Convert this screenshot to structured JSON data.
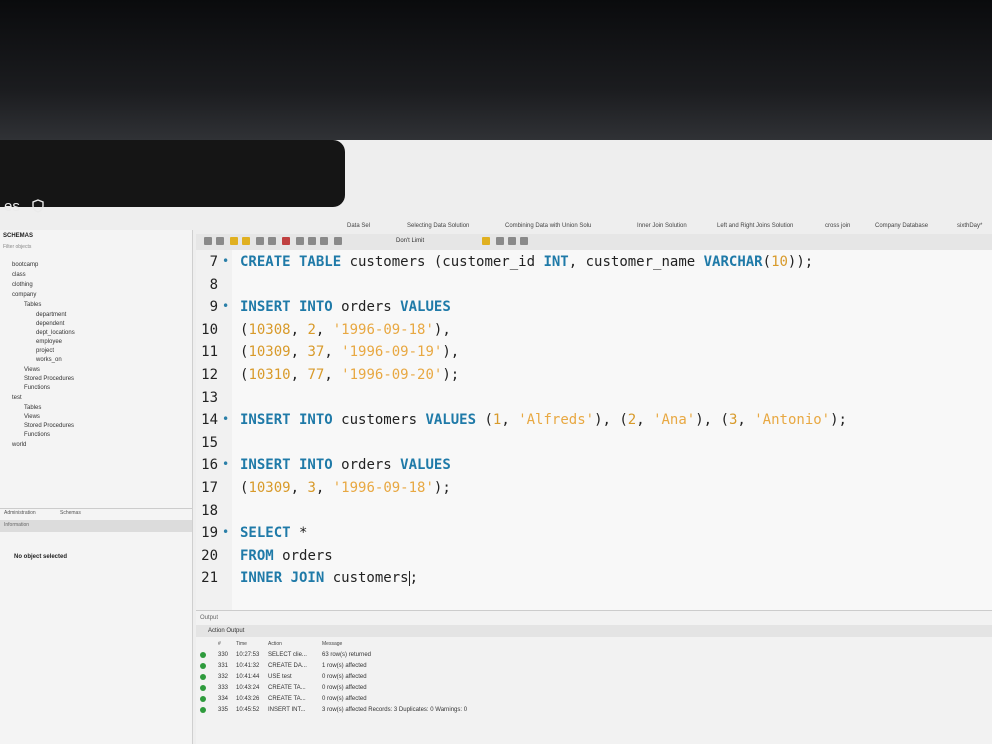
{
  "window": {
    "app_title": "es"
  },
  "query_tabs": [
    "Data Sel",
    "Selecting Data Solution",
    "Combining Data with Union Solu",
    "Inner Join Solution",
    "Left and Right Joins Solution",
    "cross join",
    "Company Database",
    "sixthDay*"
  ],
  "toolbar": {
    "limit_label": "Don't Limit"
  },
  "sidebar": {
    "header": "SCHEMAS",
    "filter_placeholder": "Filter objects",
    "tree": [
      "bootcamp",
      "class",
      "clothing",
      "company",
      "Tables",
      "department",
      "dependent",
      "dept_locations",
      "employee",
      "project",
      "works_on",
      "Views",
      "Stored Procedures",
      "Functions",
      "test",
      "Tables",
      "Views",
      "Stored Procedures",
      "Functions",
      "world"
    ],
    "bottom_tabs": [
      "Administration",
      "Schemas"
    ],
    "info_label": "Information",
    "no_object": "No object selected"
  },
  "editor": {
    "lines": [
      {
        "n": "7",
        "dot": "•",
        "c": [
          [
            "kw",
            "CREATE TABLE "
          ],
          [
            "t",
            "customers (customer_id "
          ],
          [
            "kw",
            "INT"
          ],
          [
            "t",
            ", customer_name "
          ],
          [
            "kw",
            "VARCHAR"
          ],
          [
            "t",
            "("
          ],
          [
            "num",
            "10"
          ],
          [
            "t",
            "));"
          ]
        ]
      },
      {
        "n": "8",
        "dot": "",
        "c": []
      },
      {
        "n": "9",
        "dot": "•",
        "c": [
          [
            "kw",
            "INSERT INTO "
          ],
          [
            "t",
            "orders "
          ],
          [
            "kw",
            "VALUES"
          ]
        ]
      },
      {
        "n": "10",
        "dot": "",
        "c": [
          [
            "t",
            "("
          ],
          [
            "num",
            "10308"
          ],
          [
            "t",
            ", "
          ],
          [
            "num",
            "2"
          ],
          [
            "t",
            ", "
          ],
          [
            "str",
            "'1996-09-18'"
          ],
          [
            "t",
            "),"
          ]
        ]
      },
      {
        "n": "11",
        "dot": "",
        "c": [
          [
            "t",
            "("
          ],
          [
            "num",
            "10309"
          ],
          [
            "t",
            ", "
          ],
          [
            "num",
            "37"
          ],
          [
            "t",
            ", "
          ],
          [
            "str",
            "'1996-09-19'"
          ],
          [
            "t",
            "),"
          ]
        ]
      },
      {
        "n": "12",
        "dot": "",
        "c": [
          [
            "t",
            "("
          ],
          [
            "num",
            "10310"
          ],
          [
            "t",
            ", "
          ],
          [
            "num",
            "77"
          ],
          [
            "t",
            ", "
          ],
          [
            "str",
            "'1996-09-20'"
          ],
          [
            "t",
            ");"
          ]
        ]
      },
      {
        "n": "13",
        "dot": "",
        "c": []
      },
      {
        "n": "14",
        "dot": "•",
        "c": [
          [
            "kw",
            "INSERT INTO "
          ],
          [
            "t",
            "customers "
          ],
          [
            "kw",
            "VALUES "
          ],
          [
            "t",
            "("
          ],
          [
            "num",
            "1"
          ],
          [
            "t",
            ", "
          ],
          [
            "str",
            "'Alfreds'"
          ],
          [
            "t",
            "), ("
          ],
          [
            "num",
            "2"
          ],
          [
            "t",
            ", "
          ],
          [
            "str",
            "'Ana'"
          ],
          [
            "t",
            "), ("
          ],
          [
            "num",
            "3"
          ],
          [
            "t",
            ", "
          ],
          [
            "str",
            "'Antonio'"
          ],
          [
            "t",
            ");"
          ]
        ]
      },
      {
        "n": "15",
        "dot": "",
        "c": []
      },
      {
        "n": "16",
        "dot": "•",
        "c": [
          [
            "kw",
            "INSERT INTO "
          ],
          [
            "t",
            "orders "
          ],
          [
            "kw",
            "VALUES"
          ]
        ]
      },
      {
        "n": "17",
        "dot": "",
        "c": [
          [
            "t",
            "("
          ],
          [
            "num",
            "10309"
          ],
          [
            "t",
            ", "
          ],
          [
            "num",
            "3"
          ],
          [
            "t",
            ", "
          ],
          [
            "str",
            "'1996-09-18'"
          ],
          [
            "t",
            ");"
          ]
        ]
      },
      {
        "n": "18",
        "dot": "",
        "c": []
      },
      {
        "n": "19",
        "dot": "•",
        "c": [
          [
            "kw",
            "SELECT "
          ],
          [
            "t",
            "*"
          ]
        ]
      },
      {
        "n": "20",
        "dot": "",
        "c": [
          [
            "kw",
            "FROM "
          ],
          [
            "t",
            "orders"
          ]
        ]
      },
      {
        "n": "21",
        "dot": "",
        "c": [
          [
            "kw",
            "INNER JOIN "
          ],
          [
            "t",
            "customers"
          ],
          [
            "cursor",
            ""
          ],
          [
            "t",
            ";"
          ]
        ]
      }
    ]
  },
  "output": {
    "title": "Output",
    "mode": "Action Output",
    "columns": [
      "#",
      "Time",
      "Action",
      "Message"
    ],
    "rows": [
      [
        "330",
        "10:27:53",
        "SELECT clie...",
        "63 row(s) returned"
      ],
      [
        "331",
        "10:41:32",
        "CREATE DA...",
        "1 row(s) affected"
      ],
      [
        "332",
        "10:41:44",
        "USE test",
        "0 row(s) affected"
      ],
      [
        "333",
        "10:43:24",
        "CREATE TA...",
        "0 row(s) affected"
      ],
      [
        "334",
        "10:43:26",
        "CREATE TA...",
        "0 row(s) affected"
      ],
      [
        "335",
        "10:45:52",
        "INSERT INT...",
        "3 row(s) affected Records: 3  Duplicates: 0  Warnings: 0"
      ]
    ]
  },
  "colors": {
    "keyword": "#1f7aa8",
    "number": "#d89a2a",
    "string": "#e8a842",
    "success": "#2e9b3c"
  }
}
